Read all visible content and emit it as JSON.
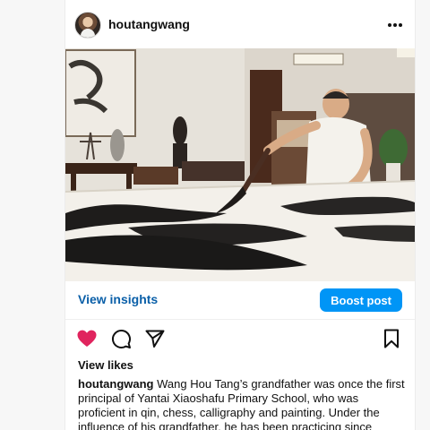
{
  "post": {
    "username": "houtangwang",
    "more_icon": "more-horizontal-icon",
    "photo_alt": "man-writing-calligraphy"
  },
  "actions": {
    "insights_label": "View insights",
    "boost_label": "Boost post",
    "like_icon": "heart-filled-icon",
    "comment_icon": "comment-icon",
    "share_icon": "send-icon",
    "save_icon": "bookmark-icon",
    "like_color": "#e0245e",
    "boost_color": "#0095f6",
    "insights_color": "#0a5fa8"
  },
  "engagement": {
    "view_likes_label": "View likes"
  },
  "caption": {
    "username": "houtangwang",
    "text": "Wang Hou Tang’s grandfather was once the first principal of Yantai Xiaoshafu Primary School, who was proficient in qin, chess, calligraphy and painting. Under the influence of his grandfather, he has been practicing since"
  }
}
